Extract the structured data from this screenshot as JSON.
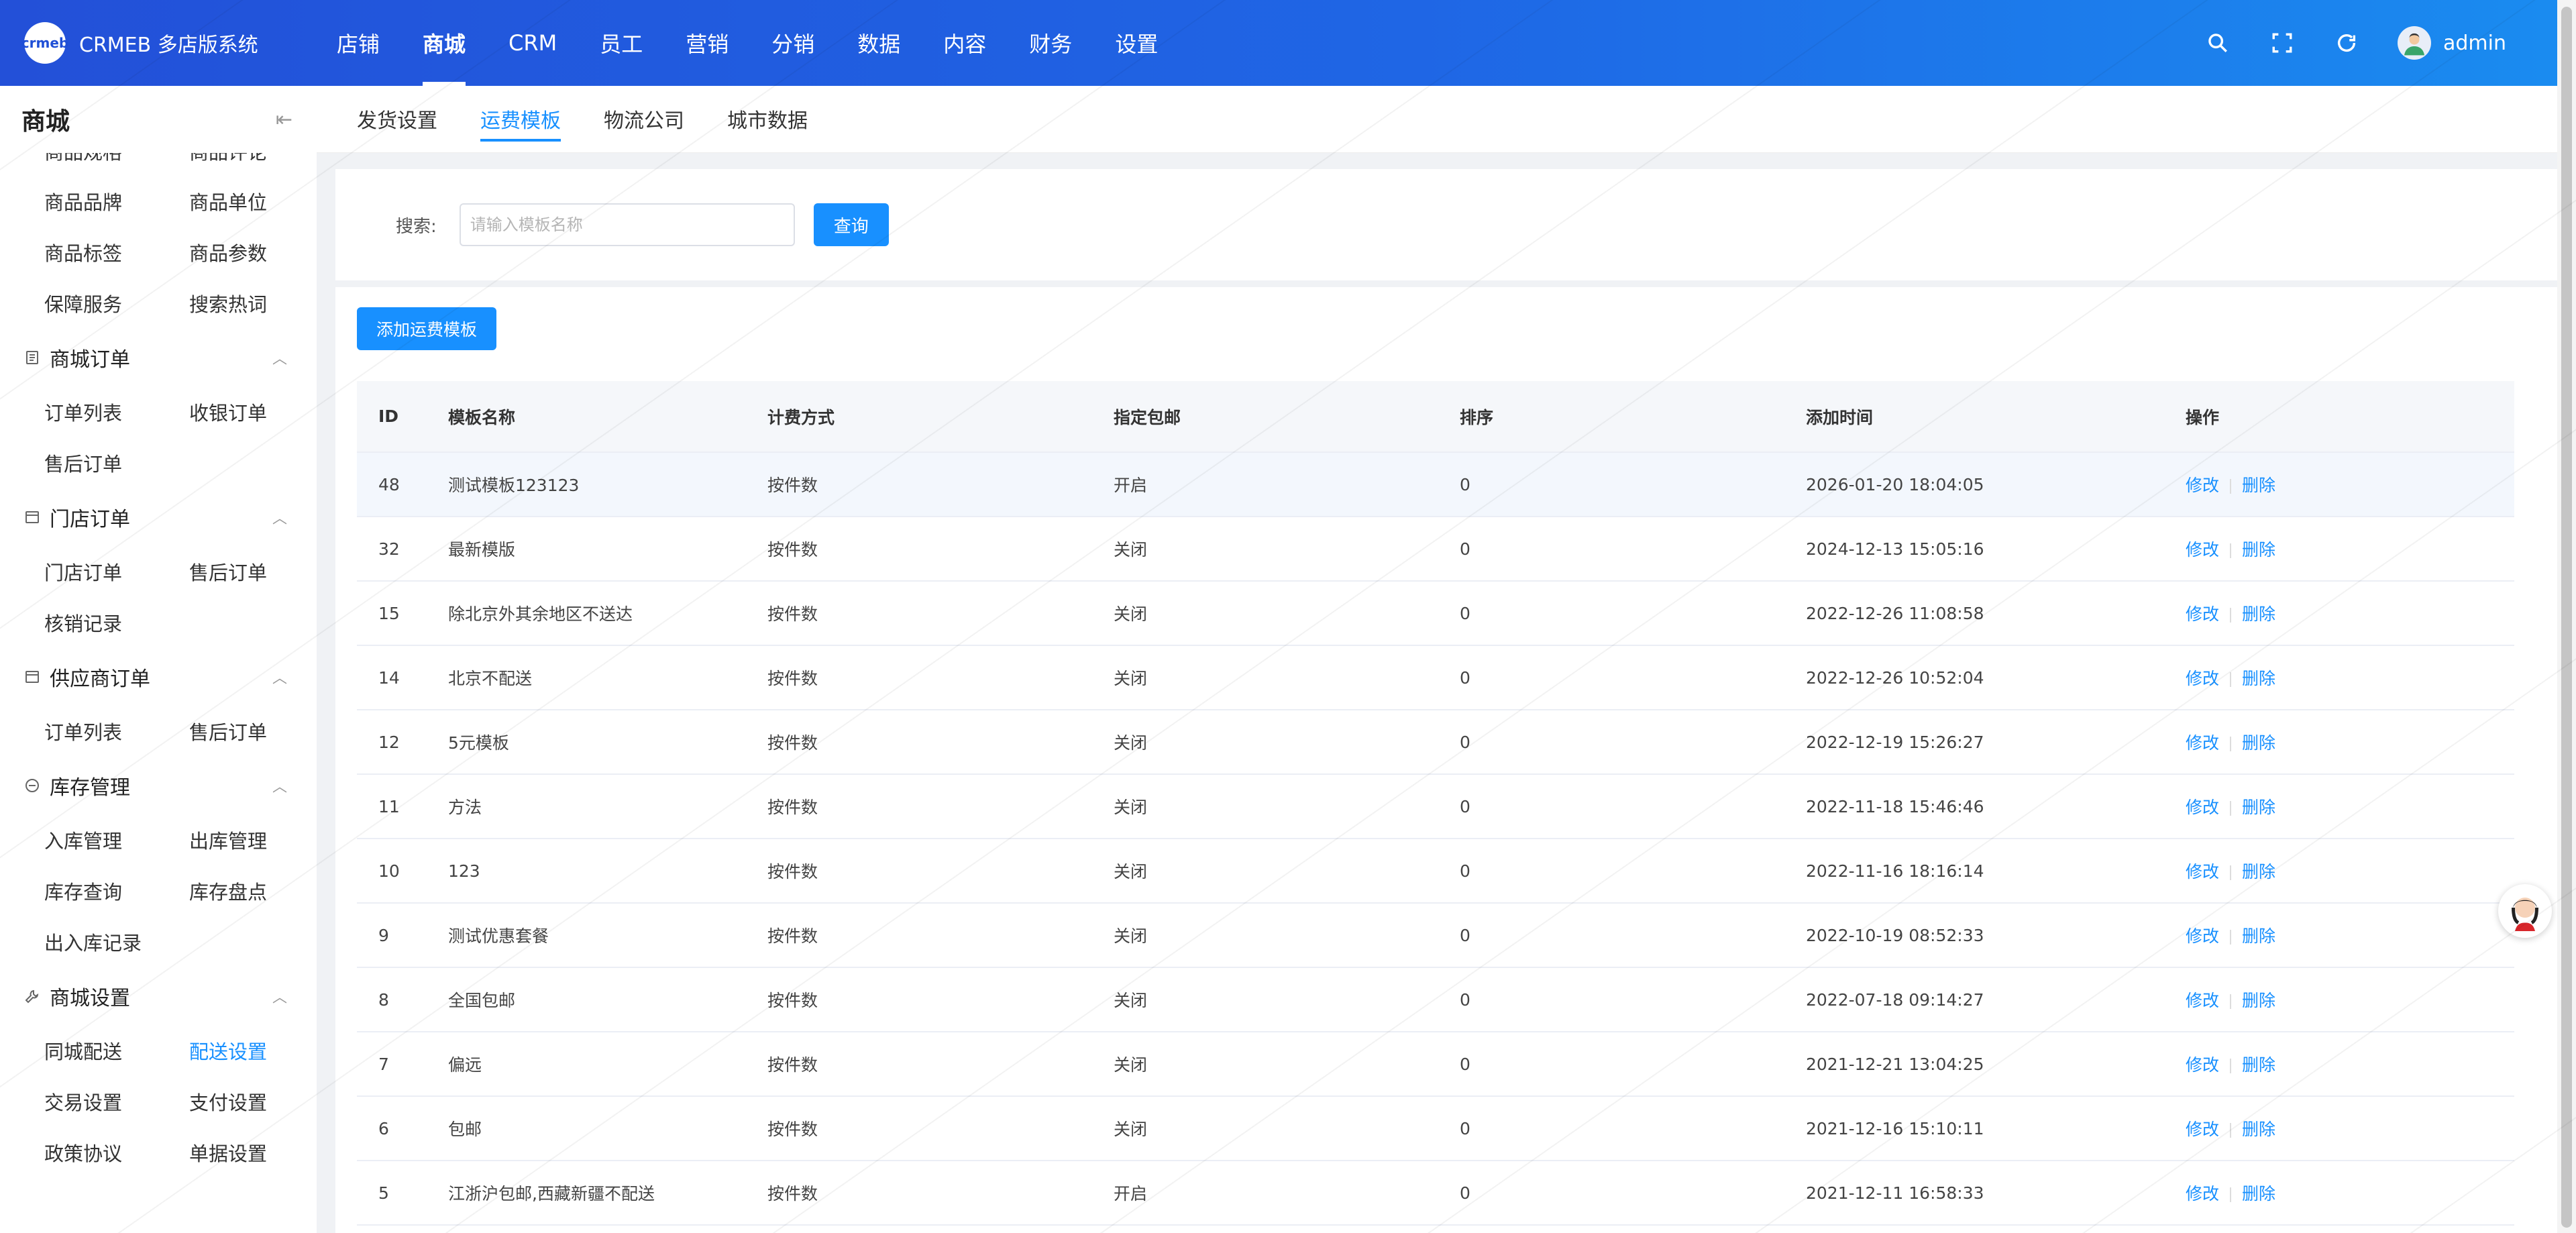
{
  "header": {
    "logo_mark": "crmeb",
    "title": "CRMEB 多店版系统",
    "nav": [
      "店铺",
      "商城",
      "CRM",
      "员工",
      "营销",
      "分销",
      "数据",
      "内容",
      "财务",
      "设置"
    ],
    "active_nav": "商城",
    "user": "admin"
  },
  "sidebar": {
    "title": "商城",
    "top_cut": [
      "商品规格",
      "商品评论"
    ],
    "top_links": [
      "商品品牌",
      "商品单位",
      "商品标签",
      "商品参数",
      "保障服务",
      "搜索热词"
    ],
    "groups": [
      {
        "title": "商城订单",
        "links": [
          "订单列表",
          "收银订单",
          "售后订单"
        ]
      },
      {
        "title": "门店订单",
        "links": [
          "门店订单",
          "售后订单",
          "核销记录"
        ]
      },
      {
        "title": "供应商订单",
        "links": [
          "订单列表",
          "售后订单"
        ]
      },
      {
        "title": "库存管理",
        "links": [
          "入库管理",
          "出库管理",
          "库存查询",
          "库存盘点",
          "出入库记录"
        ]
      },
      {
        "title": "商城设置",
        "links": [
          "同城配送",
          "配送设置",
          "交易设置",
          "支付设置",
          "政策协议",
          "单据设置"
        ]
      }
    ],
    "active_link": "配送设置"
  },
  "tabs": [
    "发货设置",
    "运费模板",
    "物流公司",
    "城市数据"
  ],
  "active_tab": "运费模板",
  "search": {
    "label": "搜索:",
    "placeholder": "请输入模板名称",
    "value": "",
    "button": "查询"
  },
  "add_button": "添加运费模板",
  "table": {
    "columns": [
      "ID",
      "模板名称",
      "计费方式",
      "指定包邮",
      "排序",
      "添加时间",
      "操作"
    ],
    "edit_label": "修改",
    "delete_label": "删除",
    "rows": [
      {
        "id": "48",
        "name": "测试模板123123",
        "way": "按件数",
        "free": "开启",
        "sort": "0",
        "time": "2026-01-20 18:04:05"
      },
      {
        "id": "32",
        "name": "最新模版",
        "way": "按件数",
        "free": "关闭",
        "sort": "0",
        "time": "2024-12-13 15:05:16"
      },
      {
        "id": "15",
        "name": "除北京外其余地区不送达",
        "way": "按件数",
        "free": "关闭",
        "sort": "0",
        "time": "2022-12-26 11:08:58"
      },
      {
        "id": "14",
        "name": "北京不配送",
        "way": "按件数",
        "free": "关闭",
        "sort": "0",
        "time": "2022-12-26 10:52:04"
      },
      {
        "id": "12",
        "name": "5元模板",
        "way": "按件数",
        "free": "关闭",
        "sort": "0",
        "time": "2022-12-19 15:26:27"
      },
      {
        "id": "11",
        "name": "方法",
        "way": "按件数",
        "free": "关闭",
        "sort": "0",
        "time": "2022-11-18 15:46:46"
      },
      {
        "id": "10",
        "name": "123",
        "way": "按件数",
        "free": "关闭",
        "sort": "0",
        "time": "2022-11-16 18:16:14"
      },
      {
        "id": "9",
        "name": "测试优惠套餐",
        "way": "按件数",
        "free": "关闭",
        "sort": "0",
        "time": "2022-10-19 08:52:33"
      },
      {
        "id": "8",
        "name": "全国包邮",
        "way": "按件数",
        "free": "关闭",
        "sort": "0",
        "time": "2022-07-18 09:14:27"
      },
      {
        "id": "7",
        "name": "偏远",
        "way": "按件数",
        "free": "关闭",
        "sort": "0",
        "time": "2021-12-21 13:04:25"
      },
      {
        "id": "6",
        "name": "包邮",
        "way": "按件数",
        "free": "关闭",
        "sort": "0",
        "time": "2021-12-16 15:10:11"
      },
      {
        "id": "5",
        "name": "江浙沪包邮,西藏新疆不配送",
        "way": "按件数",
        "free": "开启",
        "sort": "0",
        "time": "2021-12-11 16:58:33"
      }
    ]
  },
  "colors": {
    "primary": "#1890ff",
    "header_start": "#2350d8",
    "header_end": "#1a8cf0"
  }
}
